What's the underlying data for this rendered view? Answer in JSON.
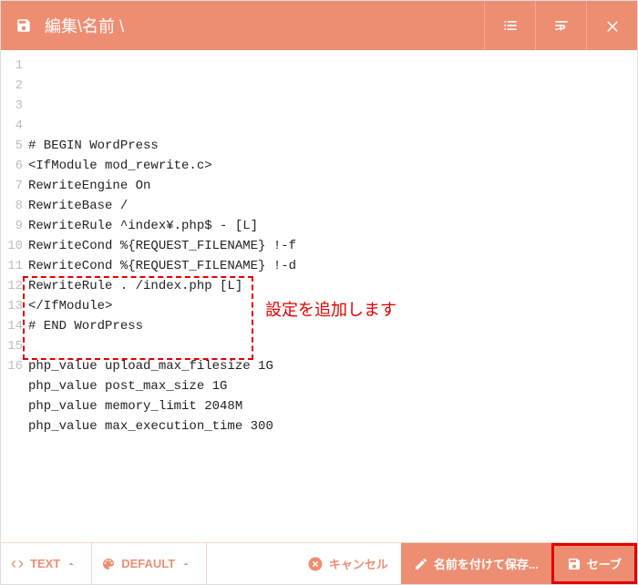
{
  "header": {
    "title": "編集\\名前 \\",
    "icons": {
      "save": "save-icon",
      "list": "list-icon",
      "wrap": "wrap-icon",
      "close": "close-icon"
    }
  },
  "code_lines": [
    "# BEGIN WordPress",
    "<IfModule mod_rewrite.c>",
    "RewriteEngine On",
    "RewriteBase /",
    "RewriteRule ^index¥.php$ - [L]",
    "RewriteCond %{REQUEST_FILENAME} !-f",
    "RewriteCond %{REQUEST_FILENAME} !-d",
    "RewriteRule . /index.php [L]",
    "</IfModule>",
    "# END WordPress",
    "",
    "php_value upload_max_filesize 1G",
    "php_value post_max_size 1G",
    "php_value memory_limit 2048M",
    "php_value max_execution_time 300",
    ""
  ],
  "annotation": "設定を追加します",
  "footer": {
    "text_mode": "TEXT",
    "theme": "DEFAULT",
    "cancel": "キャンセル",
    "save_as": "名前を付けて保存...",
    "save": "セーブ"
  }
}
